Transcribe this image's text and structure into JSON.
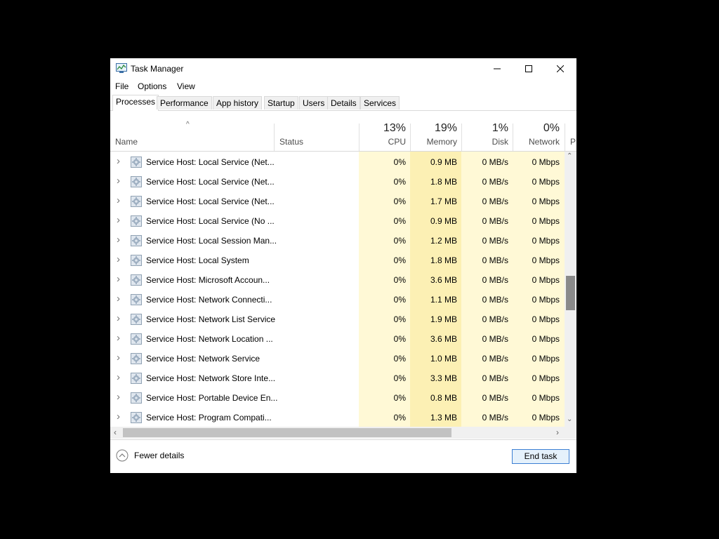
{
  "window": {
    "title": "Task Manager"
  },
  "menu": {
    "file": "File",
    "options": "Options",
    "view": "View"
  },
  "tabs": [
    "Processes",
    "Performance",
    "App history",
    "Startup",
    "Users",
    "Details",
    "Services"
  ],
  "active_tab": "Processes",
  "columns": {
    "name": "Name",
    "status": "Status",
    "cpu": {
      "percent": "13%",
      "label": "CPU"
    },
    "memory": {
      "percent": "19%",
      "label": "Memory"
    },
    "disk": {
      "percent": "1%",
      "label": "Disk"
    },
    "network": {
      "percent": "0%",
      "label": "Network"
    },
    "power_partial": "P"
  },
  "rows": [
    {
      "name": "Service Host: Local Service (Net...",
      "status": "",
      "cpu": "0%",
      "memory": "0.9 MB",
      "disk": "0 MB/s",
      "network": "0 Mbps"
    },
    {
      "name": "Service Host: Local Service (Net...",
      "status": "",
      "cpu": "0%",
      "memory": "1.8 MB",
      "disk": "0 MB/s",
      "network": "0 Mbps"
    },
    {
      "name": "Service Host: Local Service (Net...",
      "status": "",
      "cpu": "0%",
      "memory": "1.7 MB",
      "disk": "0 MB/s",
      "network": "0 Mbps"
    },
    {
      "name": "Service Host: Local Service (No ...",
      "status": "",
      "cpu": "0%",
      "memory": "0.9 MB",
      "disk": "0 MB/s",
      "network": "0 Mbps"
    },
    {
      "name": "Service Host: Local Session Man...",
      "status": "",
      "cpu": "0%",
      "memory": "1.2 MB",
      "disk": "0 MB/s",
      "network": "0 Mbps"
    },
    {
      "name": "Service Host: Local System",
      "status": "",
      "cpu": "0%",
      "memory": "1.8 MB",
      "disk": "0 MB/s",
      "network": "0 Mbps"
    },
    {
      "name": "Service Host: Microsoft Accoun...",
      "status": "",
      "cpu": "0%",
      "memory": "3.6 MB",
      "disk": "0 MB/s",
      "network": "0 Mbps"
    },
    {
      "name": "Service Host: Network Connecti...",
      "status": "",
      "cpu": "0%",
      "memory": "1.1 MB",
      "disk": "0 MB/s",
      "network": "0 Mbps"
    },
    {
      "name": "Service Host: Network List Service",
      "status": "",
      "cpu": "0%",
      "memory": "1.9 MB",
      "disk": "0 MB/s",
      "network": "0 Mbps"
    },
    {
      "name": "Service Host: Network Location ...",
      "status": "",
      "cpu": "0%",
      "memory": "3.6 MB",
      "disk": "0 MB/s",
      "network": "0 Mbps"
    },
    {
      "name": "Service Host: Network Service",
      "status": "",
      "cpu": "0%",
      "memory": "1.0 MB",
      "disk": "0 MB/s",
      "network": "0 Mbps"
    },
    {
      "name": "Service Host: Network Store Inte...",
      "status": "",
      "cpu": "0%",
      "memory": "3.3 MB",
      "disk": "0 MB/s",
      "network": "0 Mbps"
    },
    {
      "name": "Service Host: Portable Device En...",
      "status": "",
      "cpu": "0%",
      "memory": "0.8 MB",
      "disk": "0 MB/s",
      "network": "0 Mbps"
    },
    {
      "name": "Service Host: Program Compati...",
      "status": "",
      "cpu": "0%",
      "memory": "1.3 MB",
      "disk": "0 MB/s",
      "network": "0 Mbps"
    }
  ],
  "footer": {
    "fewer_details": "Fewer details",
    "end_task": "End task"
  },
  "colors": {
    "cpu_col_bg": "#fff9d6",
    "memory_col_bg": "#fcf0b4",
    "other_col_bg": "#fff9d6"
  },
  "scroll": {
    "vertical_position": 0.47
  }
}
